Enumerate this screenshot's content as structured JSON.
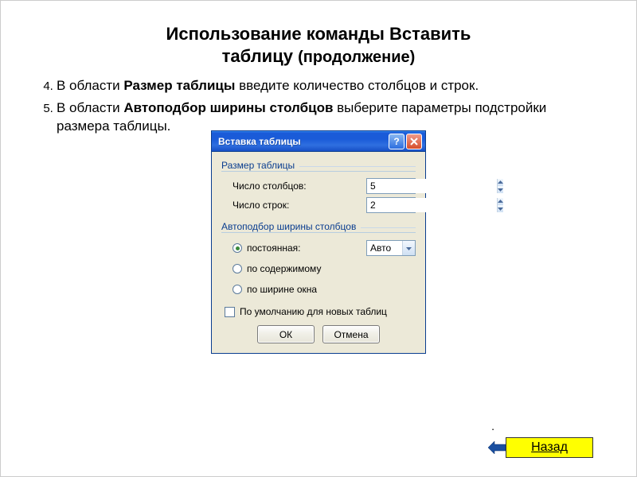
{
  "slide": {
    "title_line1": "Использование команды Вставить",
    "title_line2": "таблицу",
    "title_suffix": "(продолжение)"
  },
  "bullets": {
    "b4_prefix": "В области ",
    "b4_bold": "Размер таблицы",
    "b4_suffix": " введите количество столбцов и строк.",
    "b5_prefix": "В области ",
    "b5_bold": "Автоподбор ширины столбцов",
    "b5_suffix": " выберите параметры подстройки размера таблицы."
  },
  "dialog": {
    "title": "Вставка таблицы",
    "group_size": "Размер таблицы",
    "cols_label": "Число столбцов:",
    "cols_value": "5",
    "rows_label": "Число строк:",
    "rows_value": "2",
    "group_autofit": "Автоподбор ширины столбцов",
    "radio_fixed": "постоянная:",
    "fixed_value": "Авто",
    "radio_content": "по содержимому",
    "radio_window": "по ширине окна",
    "checkbox_default": "По умолчанию для новых таблиц",
    "ok": "ОК",
    "cancel": "Отмена"
  },
  "nav": {
    "back": "Назад"
  }
}
